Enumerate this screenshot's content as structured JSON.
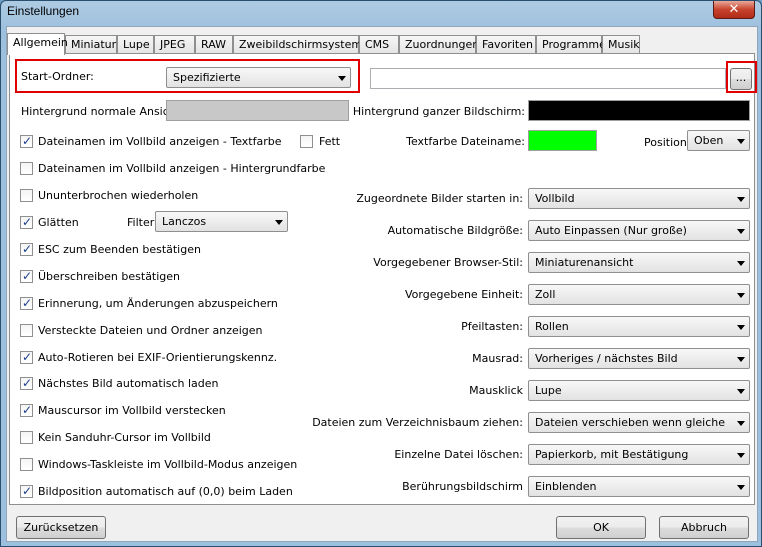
{
  "window": {
    "title": "Einstellungen",
    "close_glyph": "✕"
  },
  "tabs": [
    {
      "label": "Allgemein",
      "active": true
    },
    {
      "label": "Miniatur"
    },
    {
      "label": "Lupe"
    },
    {
      "label": "JPEG"
    },
    {
      "label": "RAW"
    },
    {
      "label": "Zweibildschirmsystem"
    },
    {
      "label": "CMS"
    },
    {
      "label": "Zuordnungen"
    },
    {
      "label": "Favoriten"
    },
    {
      "label": "Programme"
    },
    {
      "label": "Musik"
    }
  ],
  "start_folder": {
    "label": "Start-Ordner:",
    "value": "Spezifizierte",
    "path": "",
    "browse": "..."
  },
  "bg_normal": {
    "label": "Hintergrund normale Ansicht:",
    "color": "#c8c8c8"
  },
  "bg_full": {
    "label": "Hintergrund ganzer Bildschirm:",
    "color": "#000000"
  },
  "textcolor_filename": {
    "label": "Textfarbe Dateiname:",
    "color": "#00ff00"
  },
  "position": {
    "label": "Position:",
    "value": "Oben"
  },
  "bold": {
    "label": "Fett",
    "checked": false
  },
  "filter": {
    "label": "Filter:",
    "value": "Lanczos"
  },
  "checks": [
    {
      "label": "Dateinamen im Vollbild anzeigen - Textfarbe",
      "checked": true
    },
    {
      "label": "Dateinamen im Vollbild anzeigen - Hintergrundfarbe",
      "checked": false
    },
    {
      "label": "Ununterbrochen wiederholen",
      "checked": false
    },
    {
      "label": "Glätten",
      "checked": true
    },
    {
      "label": "ESC zum Beenden bestätigen",
      "checked": true
    },
    {
      "label": "Überschreiben bestätigen",
      "checked": true
    },
    {
      "label": "Erinnerung, um Änderungen abzuspeichern",
      "checked": true
    },
    {
      "label": "Versteckte Dateien und Ordner anzeigen",
      "checked": false
    },
    {
      "label": "Auto-Rotieren bei EXIF-Orientierungskennz.",
      "checked": true
    },
    {
      "label": "Nächstes Bild automatisch laden",
      "checked": true
    },
    {
      "label": "Mauscursor im Vollbild verstecken",
      "checked": true
    },
    {
      "label": "Kein Sanduhr-Cursor im Vollbild",
      "checked": false
    },
    {
      "label": "Windows-Taskleiste im Vollbild-Modus anzeigen",
      "checked": false
    },
    {
      "label": "Bildposition automatisch auf (0,0) beim Laden",
      "checked": true
    }
  ],
  "right_settings": [
    {
      "label": "Zugeordnete Bilder starten in:",
      "value": "Vollbild"
    },
    {
      "label": "Automatische Bildgröße:",
      "value": "Auto Einpassen (Nur große)"
    },
    {
      "label": "Vorgegebener Browser-Stil:",
      "value": "Miniaturenansicht"
    },
    {
      "label": "Vorgegebene Einheit:",
      "value": "Zoll"
    },
    {
      "label": "Pfeiltasten:",
      "value": "Rollen"
    },
    {
      "label": "Mausrad:",
      "value": "Vorheriges / nächstes Bild"
    },
    {
      "label": "Mausklick",
      "value": "Lupe"
    },
    {
      "label": "Dateien zum Verzeichnisbaum ziehen:",
      "value": "Dateien verschieben wenn gleiche Platte"
    },
    {
      "label": "Einzelne Datei löschen:",
      "value": "Papierkorb, mit Bestätigung"
    },
    {
      "label": "Berührungsbildschirm",
      "value": "Einblenden"
    }
  ],
  "buttons": {
    "reset": "Zurücksetzen",
    "ok": "OK",
    "cancel": "Abbruch"
  },
  "accent_colors": {
    "highlight": "#e00000"
  }
}
